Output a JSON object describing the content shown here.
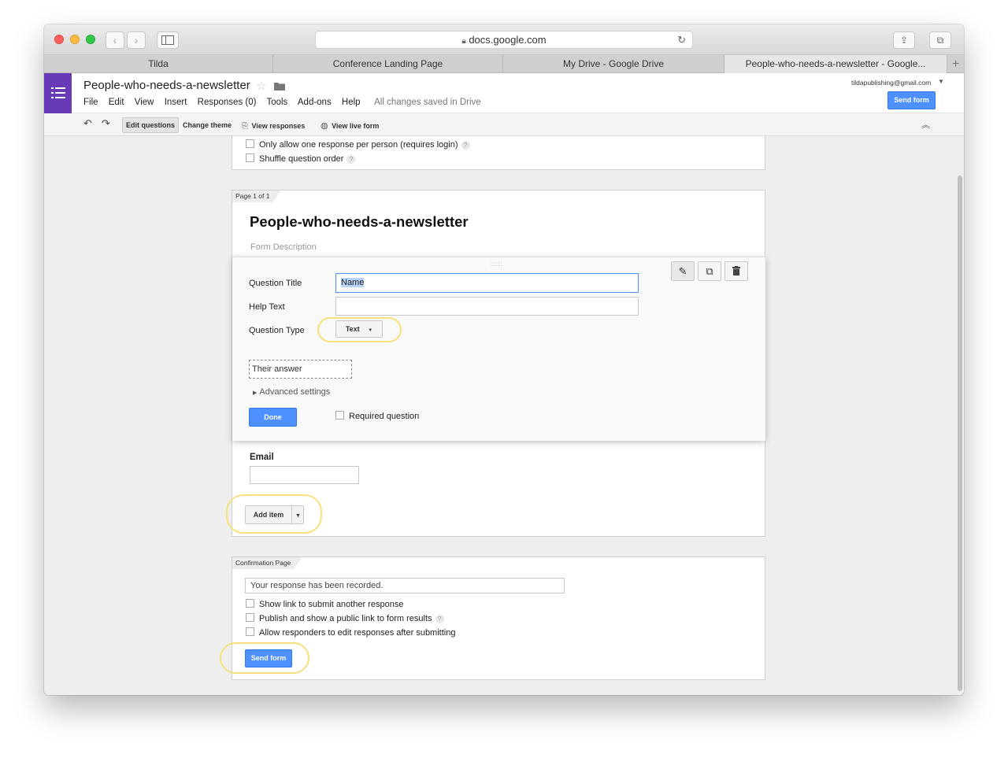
{
  "browser": {
    "url": "docs.google.com",
    "tabs": [
      "Tilda",
      "Conference Landing Page",
      "My Drive - Google Drive",
      "People-who-needs-a-newsletter - Google..."
    ],
    "icons": {
      "back": "chevron-left-icon",
      "forward": "chevron-right-icon",
      "sidebar": "sidebar-icon",
      "lock": "lock-icon",
      "reload": "reload-icon",
      "share": "share-icon",
      "tabs": "tab-overview-icon",
      "newtab": "plus-icon"
    }
  },
  "header": {
    "doc_title": "People-who-needs-a-newsletter",
    "menu": [
      "File",
      "Edit",
      "View",
      "Insert",
      "Responses (0)",
      "Tools",
      "Add-ons",
      "Help"
    ],
    "save_status": "All changes saved in Drive",
    "account": "tildapublishing@gmail.com",
    "send_form": "Send form"
  },
  "toolbar": {
    "edit_questions": "Edit questions",
    "change_theme": "Change theme",
    "view_responses": "View responses",
    "view_live_form": "View live form"
  },
  "settings": {
    "one_response": "Only allow one response per person (requires login)",
    "shuffle": "Shuffle question order",
    "help_mark": "?"
  },
  "page": {
    "page_label": "Page 1 of 1",
    "form_title": "People-who-needs-a-newsletter",
    "form_description": "Form Description"
  },
  "question_editor": {
    "title_label": "Question Title",
    "title_value": "Name",
    "help_label": "Help Text",
    "help_value": "",
    "type_label": "Question Type",
    "type_value": "Text",
    "answer_placeholder": "Their answer",
    "advanced": "Advanced settings",
    "done": "Done",
    "required": "Required question"
  },
  "email_question": {
    "label": "Email"
  },
  "add_item": "Add item",
  "confirmation": {
    "label": "Confirmation Page",
    "message": "Your response has been recorded.",
    "options": [
      "Show link to submit another response",
      "Publish and show a public link to form results",
      "Allow responders to edit responses after submitting"
    ],
    "send_form": "Send form"
  },
  "colors": {
    "brand_purple": "#673ab7",
    "primary_blue": "#4d90fe",
    "highlight": "#f8e07a"
  }
}
